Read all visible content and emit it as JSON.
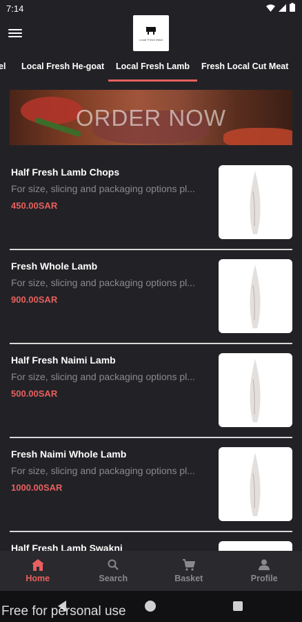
{
  "status_bar": {
    "time": "7:14"
  },
  "logo": {
    "icon": "cow-icon",
    "text": "Local Fresh Meat"
  },
  "tabs": [
    {
      "label": "el"
    },
    {
      "label": "Local Fresh He-goat"
    },
    {
      "label": "Local Fresh Lamb"
    },
    {
      "label": "Fresh Local Cut Meat"
    }
  ],
  "banner": {
    "text": "ORDER NOW"
  },
  "products": [
    {
      "name": "Half Fresh Lamb Chops",
      "description": "For size, slicing and packaging options pl...",
      "price": "450.00SAR"
    },
    {
      "name": "Fresh Whole Lamb",
      "description": "For size, slicing and packaging options pl...",
      "price": "900.00SAR"
    },
    {
      "name": "Half Fresh Naimi Lamb",
      "description": "For size, slicing and packaging options pl...",
      "price": "500.00SAR"
    },
    {
      "name": "Fresh Naimi Whole Lamb",
      "description": "For size, slicing and packaging options pl...",
      "price": "1000.00SAR"
    },
    {
      "name": "Half Fresh Lamb Swakni",
      "description": "",
      "price": ""
    }
  ],
  "bottom_nav": [
    {
      "label": "Home",
      "icon": "home-icon",
      "active": true
    },
    {
      "label": "Search",
      "icon": "search-icon",
      "active": false
    },
    {
      "label": "Basket",
      "icon": "cart-icon",
      "active": false
    },
    {
      "label": "Profile",
      "icon": "person-icon",
      "active": false
    }
  ],
  "watermark": "Free for personal use",
  "colors": {
    "background": "#222226",
    "accent": "#e8605f",
    "muted": "#8a8a8e",
    "nav_background": "#2a2a2e"
  }
}
